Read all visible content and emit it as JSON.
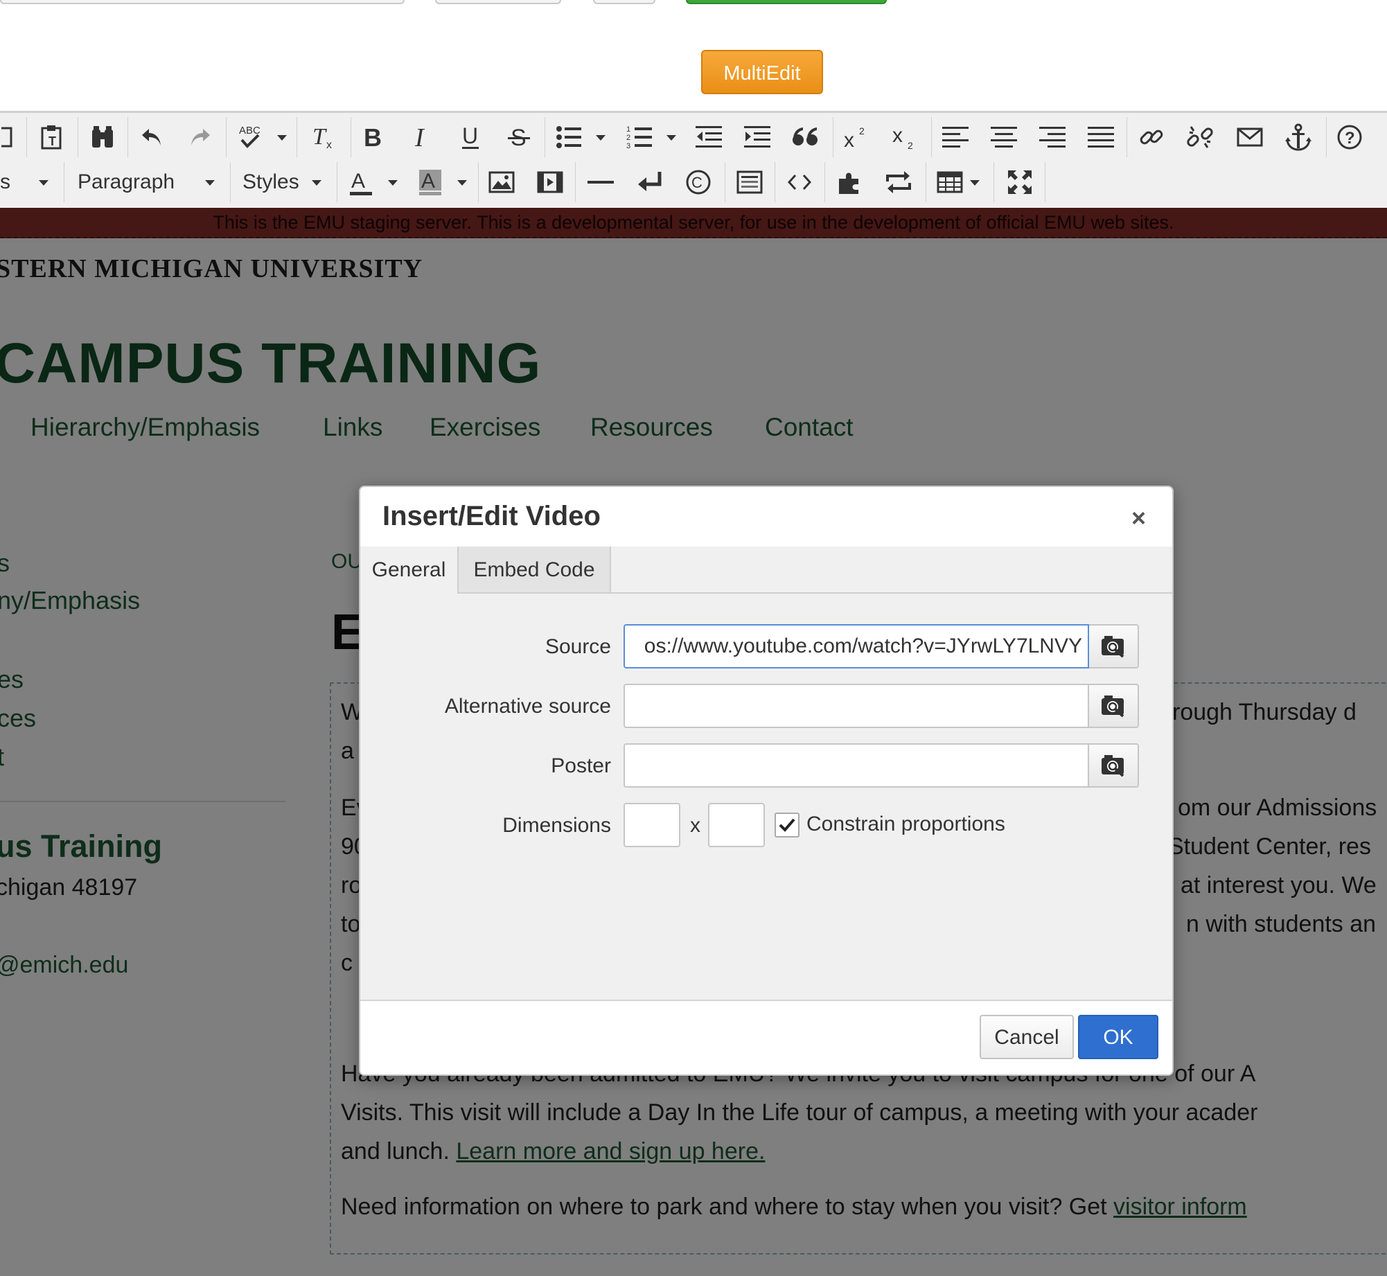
{
  "top": {
    "multiedit_label": "MultiEdit"
  },
  "toolbar": {
    "format_partial": "s",
    "block_format": "Paragraph",
    "styles": "Styles"
  },
  "site": {
    "staging_notice": "This is the EMU staging server. This is a developmental server, for use in the development of official EMU web sites.",
    "university_name": "STERN MICHIGAN UNIVERSITY",
    "site_title": "CAMPUS TRAINING",
    "nav": [
      "Hierarchy/Emphasis",
      "Links",
      "Exercises",
      "Resources",
      "Contact"
    ],
    "sidebar_links": [
      "s",
      "ny/Emphasis",
      "es",
      "ces",
      "t"
    ],
    "sidebar_heading": "us Training",
    "sidebar_address": "chigan 48197",
    "sidebar_email": "@emich.edu",
    "breadcrumb_fragment": "OU",
    "page_heading_fragment": "E",
    "content": {
      "p1_start": "W",
      "p1_line2_start": "a",
      "p1_right": "rough Thursday d",
      "p2_lines_start": [
        "Ev",
        "90",
        "ro",
        "to",
        "c"
      ],
      "p2_right": [
        "om our Admissions",
        "Student Center, res",
        "at interest you. We",
        "n with students an"
      ],
      "p3_line1": "Have you already been admitted to EMU? We invite you to visit campus for one of our A",
      "p3_line2": "Visits. This visit will include a Day In the Life tour of campus, a meeting with your acader",
      "p3_line3_text": "and lunch. ",
      "p3_link": "Learn more and sign up here.",
      "p4_text": "Need information on where to park and where to stay when you visit? Get ",
      "p4_link": "visitor inform"
    }
  },
  "dialog": {
    "title": "Insert/Edit Video",
    "close_glyph": "×",
    "tabs": [
      "General",
      "Embed Code"
    ],
    "fields": {
      "source_label": "Source",
      "source_value": "os://www.youtube.com/watch?v=JYrwLY7LNVY",
      "alt_source_label": "Alternative source",
      "alt_source_value": "",
      "poster_label": "Poster",
      "poster_value": "",
      "dimensions_label": "Dimensions",
      "dim_separator": "x",
      "width_value": "",
      "height_value": "",
      "constrain_label": "Constrain proportions",
      "constrain_checked": true
    },
    "buttons": {
      "cancel": "Cancel",
      "ok": "OK"
    }
  },
  "colors": {
    "accent_orange": "#ea8f16",
    "ok_blue": "#2f6fcf",
    "staging_red": "#8a2f2a",
    "emu_green": "#144d2b"
  },
  "icons": [
    "browse-icon",
    "check-icon",
    "close-icon"
  ]
}
